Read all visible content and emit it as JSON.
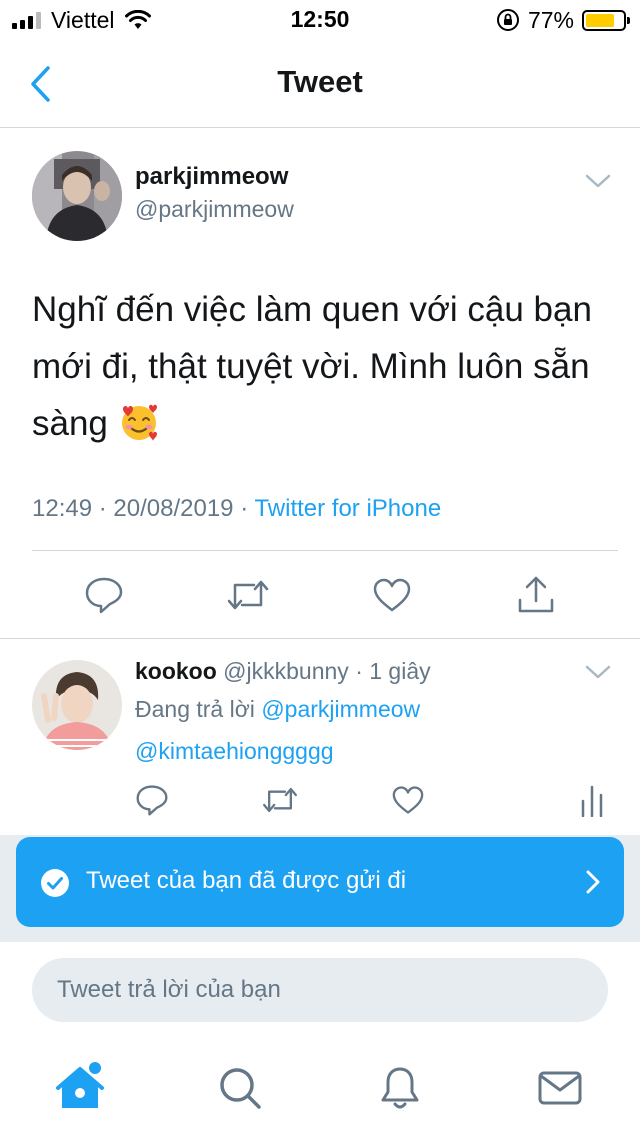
{
  "status_bar": {
    "carrier": "Viettel",
    "time": "12:50",
    "battery": "77%",
    "battery_level": 0.77
  },
  "nav": {
    "title": "Tweet"
  },
  "main_tweet": {
    "name": "parkjimmeow",
    "handle": "@parkjimmeow",
    "text": "Nghĩ đến việc làm quen với cậu bạn mới đi, thật tuyệt vời. Mình luôn sẵn sàng",
    "emoji": "smiling-face-with-hearts",
    "time": "12:49",
    "separator": "·",
    "date": "20/08/2019",
    "source": "Twitter for iPhone"
  },
  "reply": {
    "name": "kookoo",
    "handle": "@jkkkbunny",
    "time": "· 1 giây",
    "replying_label": "Đang trả lời",
    "replying_to": "@parkjimmeow",
    "text": "@kimtaehionggggg"
  },
  "toast": {
    "text": "Tweet của bạn đã được gửi đi"
  },
  "compose": {
    "placeholder": "Tweet trả lời của bạn"
  },
  "colors": {
    "accent": "#1da1f2",
    "secondary_text": "#657786",
    "divider": "#d4d8db"
  }
}
